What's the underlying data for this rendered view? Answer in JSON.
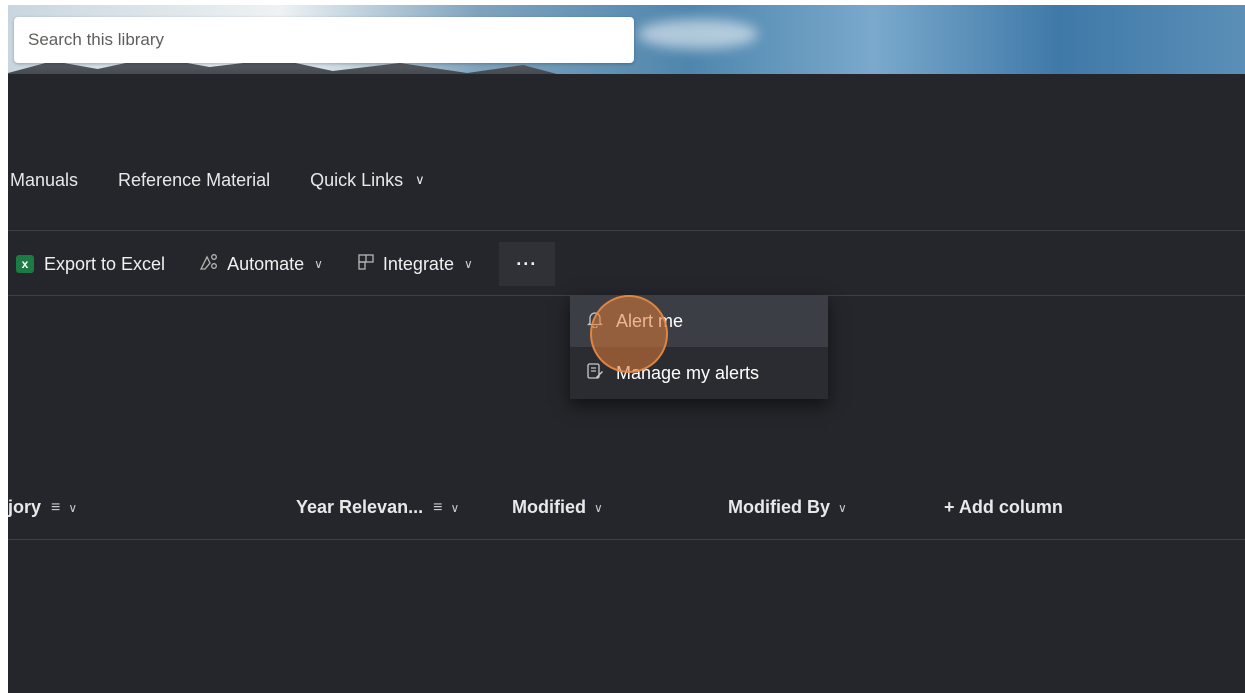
{
  "search": {
    "placeholder": "Search this library"
  },
  "nav": {
    "items": [
      {
        "label": "Manuals"
      },
      {
        "label": "Reference Material"
      },
      {
        "label": "Quick Links"
      }
    ]
  },
  "commandbar": {
    "export_label": "Export to Excel",
    "export_icon_letter": "x",
    "automate_label": "Automate",
    "integrate_label": "Integrate",
    "more_label": "···"
  },
  "menu": {
    "items": [
      {
        "label": "Alert me",
        "icon": "bell-icon"
      },
      {
        "label": "Manage my alerts",
        "icon": "manage-alerts-icon"
      }
    ]
  },
  "columns": {
    "category": "jory",
    "year_relevance": "Year Relevan...",
    "modified": "Modified",
    "modified_by": "Modified By",
    "add_column": "+ Add column"
  },
  "colors": {
    "background": "#24262b",
    "menu_background": "#2a2c31",
    "menu_hover": "#3b3e44",
    "excel_green": "#1d7a44",
    "cursor_highlight": "#de7a36"
  }
}
